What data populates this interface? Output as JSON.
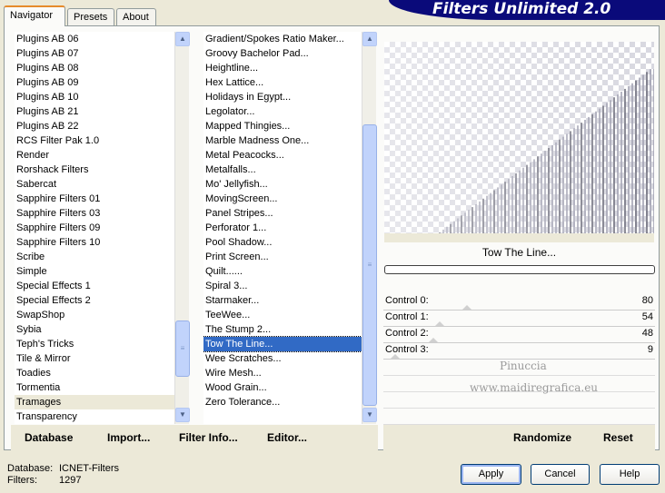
{
  "window": {
    "title": "Filters Unlimited 2.0"
  },
  "tabs": [
    "Navigator",
    "Presets",
    "About"
  ],
  "categories": {
    "items": [
      "Plugins AB 06",
      "Plugins AB 07",
      "Plugins AB 08",
      "Plugins AB 09",
      "Plugins AB 10",
      "Plugins AB 21",
      "Plugins AB 22",
      "RCS Filter Pak 1.0",
      "Render",
      "Rorshack Filters",
      "Sabercat",
      "Sapphire Filters 01",
      "Sapphire Filters 03",
      "Sapphire Filters 09",
      "Sapphire Filters 10",
      "Scribe",
      "Simple",
      "Special Effects 1",
      "Special Effects 2",
      "SwapShop",
      "Sybia",
      "Teph's Tricks",
      "Tile & Mirror",
      "Toadies",
      "Tormentia",
      "Tramages",
      "Transparency"
    ],
    "selected": "Tramages"
  },
  "filters": {
    "items": [
      "Gradient/Spokes Ratio Maker...",
      "Groovy Bachelor Pad...",
      "Heightline...",
      "Hex Lattice...",
      "Holidays in Egypt...",
      "Legolator...",
      "Mapped Thingies...",
      "Marble Madness One...",
      "Metal Peacocks...",
      "Metalfalls...",
      "Mo' Jellyfish...",
      "MovingScreen...",
      "Panel Stripes...",
      "Perforator 1...",
      "Pool Shadow...",
      "Print Screen...",
      "Quilt......",
      "Spiral 3...",
      "Starmaker...",
      "TeeWee...",
      "The Stump 2...",
      "Tow The Line...",
      "Wee Scratches...",
      "Wire Mesh...",
      "Wood Grain...",
      "Zero Tolerance..."
    ],
    "selected": "Tow The Line..."
  },
  "preview": {
    "filter_name": "Tow The Line..."
  },
  "controls": [
    {
      "label": "Control 0:",
      "value": 80
    },
    {
      "label": "Control 1:",
      "value": 54
    },
    {
      "label": "Control 2:",
      "value": 48
    },
    {
      "label": "Control 3:",
      "value": 9
    }
  ],
  "watermark": {
    "line1": "Pinuccia",
    "line2": "www.maidiregrafica.eu"
  },
  "toolbar": {
    "database": "Database",
    "import": "Import...",
    "filter_info": "Filter Info...",
    "editor": "Editor...",
    "randomize": "Randomize",
    "reset": "Reset"
  },
  "status": {
    "database_label": "Database:",
    "database_value": "ICNET-Filters",
    "filters_label": "Filters:",
    "filters_value": "1297"
  },
  "buttons": {
    "apply": "Apply",
    "cancel": "Cancel",
    "help": "Help"
  },
  "colors": {
    "banner": "#0a0a7a",
    "selection": "#316ac5",
    "accent_tab": "#e68b2c"
  }
}
